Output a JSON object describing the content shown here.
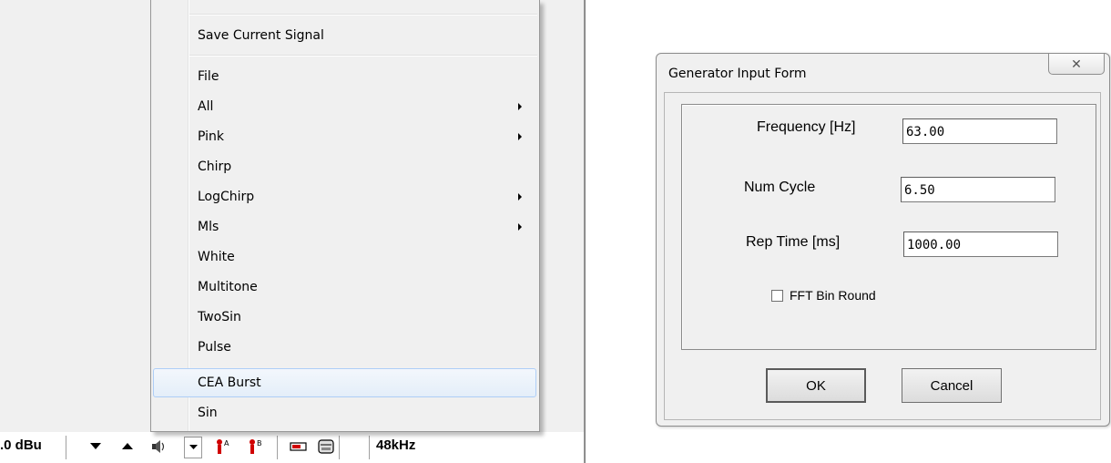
{
  "menu": {
    "items": [
      {
        "label": "Save Current Signal",
        "submenu": false
      },
      {
        "label": "File",
        "submenu": false
      },
      {
        "label": "All",
        "submenu": true
      },
      {
        "label": "Pink",
        "submenu": true
      },
      {
        "label": "Chirp",
        "submenu": false
      },
      {
        "label": "LogChirp",
        "submenu": true
      },
      {
        "label": "Mls",
        "submenu": true
      },
      {
        "label": "White",
        "submenu": false
      },
      {
        "label": "Multitone",
        "submenu": false
      },
      {
        "label": "TwoSin",
        "submenu": false
      },
      {
        "label": "Pulse",
        "submenu": false
      },
      {
        "label": "CEA Burst",
        "submenu": false,
        "highlighted": true
      },
      {
        "label": "Sin",
        "submenu": false
      }
    ]
  },
  "statusbar": {
    "level": ".0 dBu",
    "samplerate": "48kHz",
    "icons": [
      "triangle-down-icon",
      "triangle-up-icon",
      "speaker-icon",
      "dropdown-arrow-icon",
      "channel-a-icon",
      "channel-b-icon",
      "battery-icon",
      "device-icon"
    ]
  },
  "dialog": {
    "title": "Generator Input Form",
    "close_glyph": "✕",
    "fields": {
      "frequency": {
        "label": "Frequency [Hz]",
        "value": "63.00"
      },
      "num_cycle": {
        "label": "Num Cycle",
        "value": "6.50"
      },
      "rep_time": {
        "label": "Rep Time [ms]",
        "value": "1000.00"
      }
    },
    "checkbox": {
      "label": "FFT Bin Round",
      "checked": false
    },
    "ok_label": "OK",
    "cancel_label": "Cancel"
  },
  "colors": {
    "menu_highlight_border": "#aecef7",
    "menu_background": "#f0f0f0",
    "dialog_background": "#f0f0f0"
  }
}
